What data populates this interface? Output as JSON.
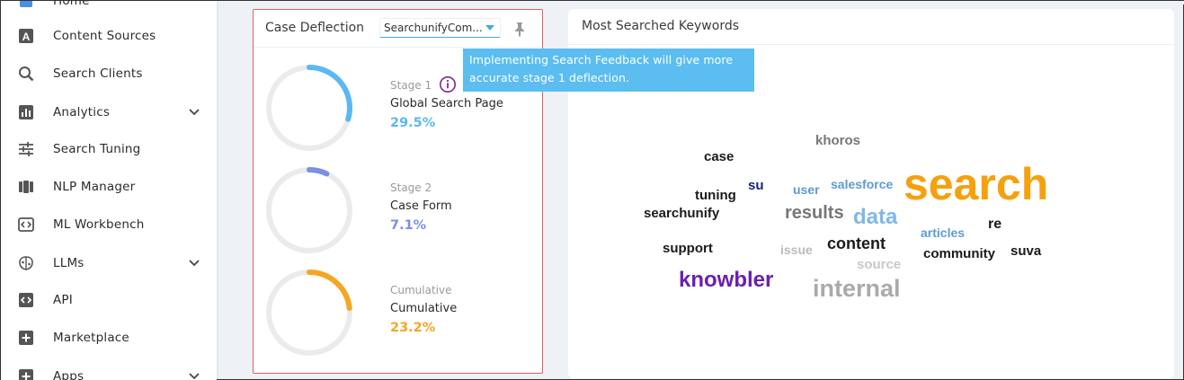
{
  "sidebar": {
    "items": [
      {
        "label": "Home",
        "icon": "home-icon"
      },
      {
        "label": "Content Sources",
        "icon": "content-sources-icon"
      },
      {
        "label": "Search Clients",
        "icon": "search-icon"
      },
      {
        "label": "Analytics",
        "icon": "analytics-icon",
        "expandable": true
      },
      {
        "label": "Search Tuning",
        "icon": "tuning-sliders-icon"
      },
      {
        "label": "NLP Manager",
        "icon": "nlp-icon"
      },
      {
        "label": "ML Workbench",
        "icon": "ml-workbench-icon"
      },
      {
        "label": "LLMs",
        "icon": "brain-icon",
        "expandable": true
      },
      {
        "label": "API",
        "icon": "api-icon"
      },
      {
        "label": "Marketplace",
        "icon": "plus-box-icon"
      },
      {
        "label": "Apps",
        "icon": "plus-box-icon",
        "expandable": true
      }
    ]
  },
  "case_deflection": {
    "title": "Case Deflection",
    "dropdown_value": "SearchunifyCom...",
    "stages": [
      {
        "label": "Stage 1",
        "name": "Global Search Page",
        "value": "29.5%",
        "fraction": 0.295,
        "color": "#5bb8f0"
      },
      {
        "label": "Stage 2",
        "name": "Case Form",
        "value": "7.1%",
        "fraction": 0.071,
        "color": "#7b8fe6"
      },
      {
        "label": "Cumulative",
        "name": "Cumulative",
        "value": "23.2%",
        "fraction": 0.232,
        "color": "#f5a623"
      }
    ],
    "tooltip": "Implementing Search Feedback will give more accurate stage 1 deflection."
  },
  "keywords": {
    "title": "Most Searched Keywords",
    "words": [
      {
        "text": "khoros",
        "color": "#777777"
      },
      {
        "text": "case",
        "color": "#1a1a1a"
      },
      {
        "text": "search",
        "color": "#f5a10d"
      },
      {
        "text": "su",
        "color": "#1a237e"
      },
      {
        "text": "user",
        "color": "#5b9bd5"
      },
      {
        "text": "salesforce",
        "color": "#5b9bd5"
      },
      {
        "text": "tuning",
        "color": "#1a1a1a"
      },
      {
        "text": "searchunify",
        "color": "#1a1a1a"
      },
      {
        "text": "results",
        "color": "#777777"
      },
      {
        "text": "data",
        "color": "#7fb8e6"
      },
      {
        "text": "articles",
        "color": "#5b9bd5"
      },
      {
        "text": "re",
        "color": "#1a1a1a"
      },
      {
        "text": "support",
        "color": "#1a1a1a"
      },
      {
        "text": "issue",
        "color": "#bbbbbb"
      },
      {
        "text": "content",
        "color": "#1a1a1a"
      },
      {
        "text": "community",
        "color": "#1a1a1a"
      },
      {
        "text": "suva",
        "color": "#1a1a1a"
      },
      {
        "text": "source",
        "color": "#c8c8c8"
      },
      {
        "text": "knowbler",
        "color": "#6a1fb0"
      },
      {
        "text": "internal",
        "color": "#aaaaaa"
      }
    ]
  }
}
